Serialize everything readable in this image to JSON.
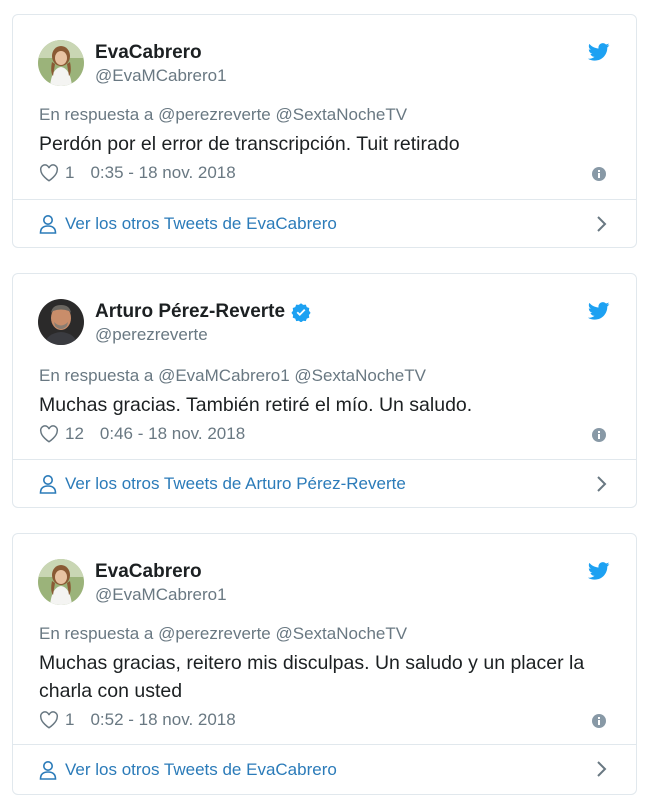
{
  "colors": {
    "twitter_blue": "#1da1f2",
    "link_blue": "#2b7bb9",
    "text_dark": "#1c2022",
    "text_gray": "#697882",
    "border": "#e1e8ed"
  },
  "tweets": [
    {
      "display_name": "EvaCabrero",
      "handle": "@EvaMCabrero1",
      "verified": false,
      "reply_to": "En respuesta a @perezreverte @SextaNocheTV",
      "text": "Perdón por el error de transcripción. Tuit retirado",
      "likes": "1",
      "timestamp": "0:35 - 18 nov. 2018",
      "footer_link": "Ver los otros Tweets de EvaCabrero",
      "avatar_icon": "avatar-photo"
    },
    {
      "display_name": "Arturo Pérez-Reverte",
      "handle": "@perezreverte",
      "verified": true,
      "reply_to": "En respuesta a @EvaMCabrero1 @SextaNocheTV",
      "text": "Muchas gracias. También retiré el mío. Un saludo.",
      "likes": "12",
      "timestamp": "0:46 - 18 nov. 2018",
      "footer_link": "Ver los otros Tweets de Arturo Pérez-Reverte",
      "avatar_icon": "avatar-photo"
    },
    {
      "display_name": "EvaCabrero",
      "handle": "@EvaMCabrero1",
      "verified": false,
      "reply_to": "En respuesta a @perezreverte @SextaNocheTV",
      "text": "Muchas gracias, reitero mis disculpas. Un saludo y un placer la charla con usted",
      "likes": "1",
      "timestamp": "0:52 - 18 nov. 2018",
      "footer_link": "Ver los otros Tweets de EvaCabrero",
      "avatar_icon": "avatar-photo"
    }
  ]
}
